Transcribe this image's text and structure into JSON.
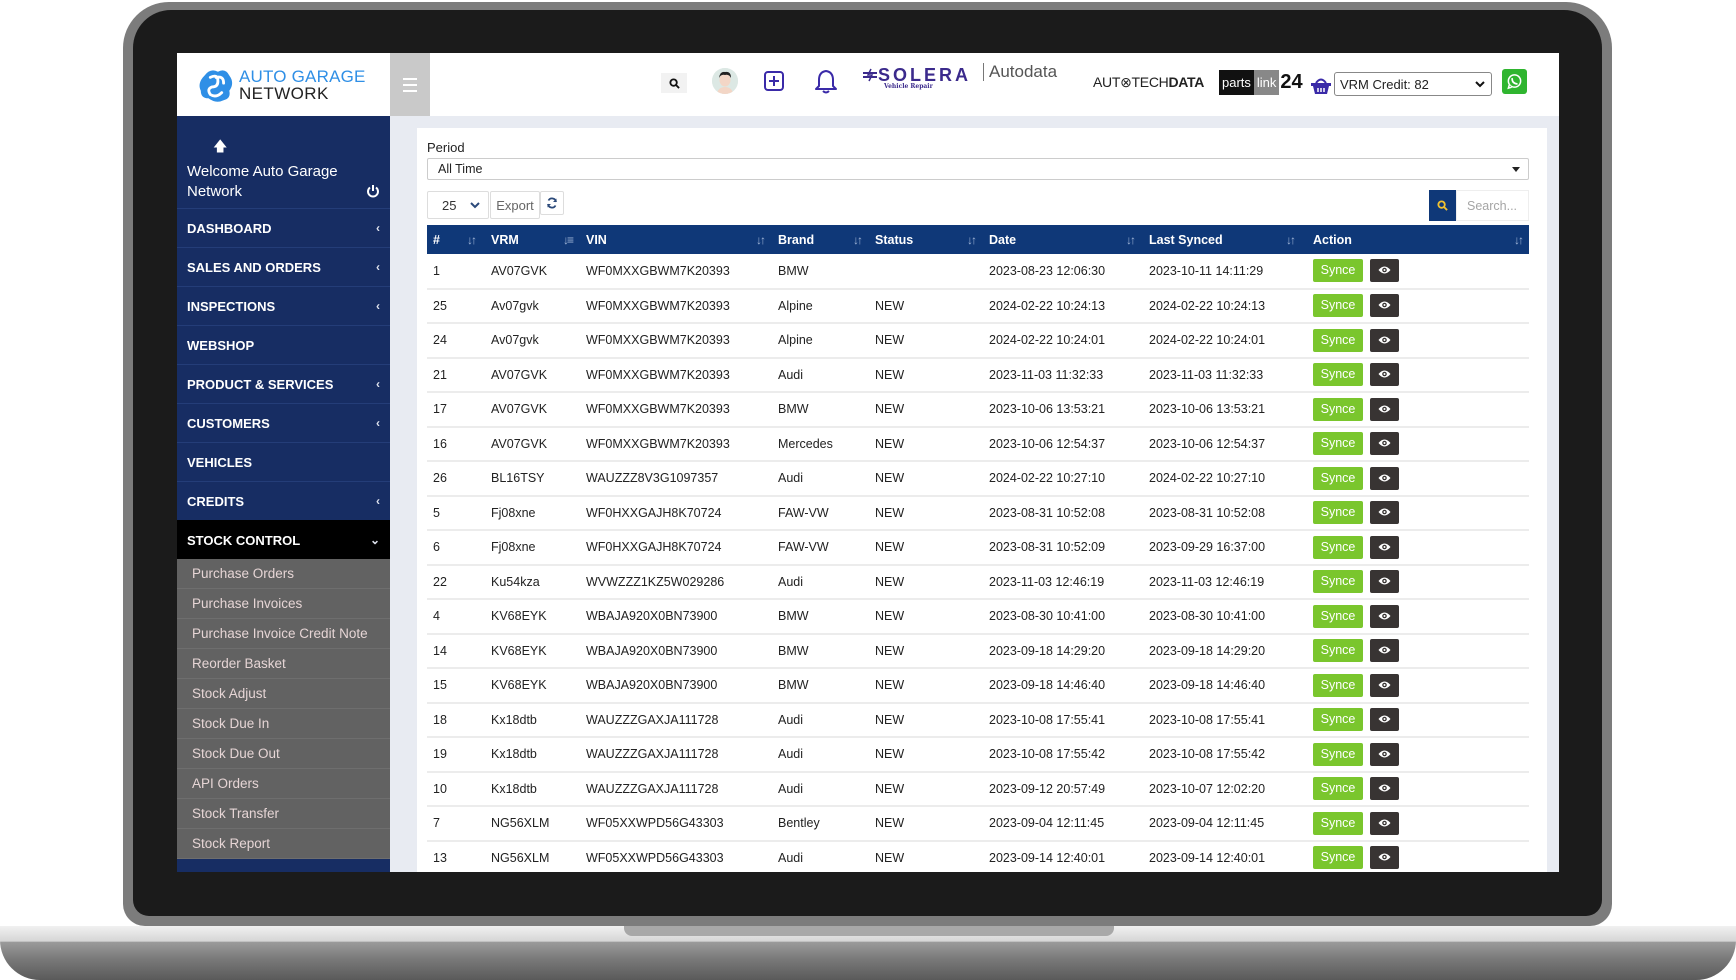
{
  "brand": {
    "logo_line1": "AUTO GARAGE",
    "logo_line2": "NETWORK",
    "accent_color": "#2f8fe6",
    "sidebar_color": "#172d63",
    "table_header_color": "#0f3878",
    "synce_button_color": "#7ac62d"
  },
  "topbar": {
    "partners": {
      "solera": "SOLERA",
      "solera_sub": "Vehicle Repair",
      "autodata": "Autodata",
      "autotech_prefix": "AUT",
      "autotech_mid": "TECH",
      "autotech_suffix": "DATA",
      "partslink_a": "parts",
      "partslink_b": "link",
      "partslink_c": "24"
    },
    "vrm_credit": "VRM Credit: 82"
  },
  "sidebar": {
    "welcome": "Welcome Auto Garage Network",
    "items": [
      {
        "label": "DASHBOARD",
        "chevron": "‹"
      },
      {
        "label": "SALES AND ORDERS",
        "chevron": "‹"
      },
      {
        "label": "INSPECTIONS",
        "chevron": "‹"
      },
      {
        "label": "WEBSHOP",
        "chevron": ""
      },
      {
        "label": "PRODUCT & SERVICES",
        "chevron": "‹"
      },
      {
        "label": "CUSTOMERS",
        "chevron": "‹"
      },
      {
        "label": "VEHICLES",
        "chevron": ""
      },
      {
        "label": "CREDITS",
        "chevron": "‹"
      },
      {
        "label": "STOCK CONTROL",
        "chevron": "⌄"
      }
    ],
    "submenu": [
      "Purchase Orders",
      "Purchase Invoices",
      "Purchase Invoice Credit Note",
      "Reorder Basket",
      "Stock Adjust",
      "Stock Due In",
      "Stock Due Out",
      "API Orders",
      "Stock Transfer",
      "Stock Report"
    ]
  },
  "filters": {
    "period_label": "Period",
    "period_value": "All Time",
    "page_size": "25",
    "export_label": "Export",
    "search_placeholder": "Search..."
  },
  "table": {
    "columns": [
      "#",
      "VRM",
      "VIN",
      "Brand",
      "Status",
      "Date",
      "Last Synced",
      "Action"
    ],
    "action_label": "Synce",
    "rows": [
      {
        "id": "1",
        "vrm": "AV07GVK",
        "vin": "WF0MXXGBWM7K20393",
        "brand": "BMW",
        "status": "",
        "date": "2023-08-23 12:06:30",
        "synced": "2023-10-11 14:11:29"
      },
      {
        "id": "25",
        "vrm": "Av07gvk",
        "vin": "WF0MXXGBWM7K20393",
        "brand": "Alpine",
        "status": "NEW",
        "date": "2024-02-22 10:24:13",
        "synced": "2024-02-22 10:24:13"
      },
      {
        "id": "24",
        "vrm": "Av07gvk",
        "vin": "WF0MXXGBWM7K20393",
        "brand": "Alpine",
        "status": "NEW",
        "date": "2024-02-22 10:24:01",
        "synced": "2024-02-22 10:24:01"
      },
      {
        "id": "21",
        "vrm": "AV07GVK",
        "vin": "WF0MXXGBWM7K20393",
        "brand": "Audi",
        "status": "NEW",
        "date": "2023-11-03 11:32:33",
        "synced": "2023-11-03 11:32:33"
      },
      {
        "id": "17",
        "vrm": "AV07GVK",
        "vin": "WF0MXXGBWM7K20393",
        "brand": "BMW",
        "status": "NEW",
        "date": "2023-10-06 13:53:21",
        "synced": "2023-10-06 13:53:21"
      },
      {
        "id": "16",
        "vrm": "AV07GVK",
        "vin": "WF0MXXGBWM7K20393",
        "brand": "Mercedes",
        "status": "NEW",
        "date": "2023-10-06 12:54:37",
        "synced": "2023-10-06 12:54:37"
      },
      {
        "id": "26",
        "vrm": "BL16TSY",
        "vin": "WAUZZZ8V3G1097357",
        "brand": "Audi",
        "status": "NEW",
        "date": "2024-02-22 10:27:10",
        "synced": "2024-02-22 10:27:10"
      },
      {
        "id": "5",
        "vrm": "Fj08xne",
        "vin": "WF0HXXGAJH8K70724",
        "brand": "FAW-VW",
        "status": "NEW",
        "date": "2023-08-31 10:52:08",
        "synced": "2023-08-31 10:52:08"
      },
      {
        "id": "6",
        "vrm": "Fj08xne",
        "vin": "WF0HXXGAJH8K70724",
        "brand": "FAW-VW",
        "status": "NEW",
        "date": "2023-08-31 10:52:09",
        "synced": "2023-09-29 16:37:00"
      },
      {
        "id": "22",
        "vrm": "Ku54kza",
        "vin": "WVWZZZ1KZ5W029286",
        "brand": "Audi",
        "status": "NEW",
        "date": "2023-11-03 12:46:19",
        "synced": "2023-11-03 12:46:19"
      },
      {
        "id": "4",
        "vrm": "KV68EYK",
        "vin": "WBAJA920X0BN73900",
        "brand": "BMW",
        "status": "NEW",
        "date": "2023-08-30 10:41:00",
        "synced": "2023-08-30 10:41:00"
      },
      {
        "id": "14",
        "vrm": "KV68EYK",
        "vin": "WBAJA920X0BN73900",
        "brand": "BMW",
        "status": "NEW",
        "date": "2023-09-18 14:29:20",
        "synced": "2023-09-18 14:29:20"
      },
      {
        "id": "15",
        "vrm": "KV68EYK",
        "vin": "WBAJA920X0BN73900",
        "brand": "BMW",
        "status": "NEW",
        "date": "2023-09-18 14:46:40",
        "synced": "2023-09-18 14:46:40"
      },
      {
        "id": "18",
        "vrm": "Kx18dtb",
        "vin": "WAUZZZGAXJA111728",
        "brand": "Audi",
        "status": "NEW",
        "date": "2023-10-08 17:55:41",
        "synced": "2023-10-08 17:55:41"
      },
      {
        "id": "19",
        "vrm": "Kx18dtb",
        "vin": "WAUZZZGAXJA111728",
        "brand": "Audi",
        "status": "NEW",
        "date": "2023-10-08 17:55:42",
        "synced": "2023-10-08 17:55:42"
      },
      {
        "id": "10",
        "vrm": "Kx18dtb",
        "vin": "WAUZZZGAXJA111728",
        "brand": "Audi",
        "status": "NEW",
        "date": "2023-09-12 20:57:49",
        "synced": "2023-10-07 12:02:20"
      },
      {
        "id": "7",
        "vrm": "NG56XLM",
        "vin": "WF05XXWPD56G43303",
        "brand": "Bentley",
        "status": "NEW",
        "date": "2023-09-04 12:11:45",
        "synced": "2023-09-04 12:11:45"
      },
      {
        "id": "13",
        "vrm": "NG56XLM",
        "vin": "WF05XXWPD56G43303",
        "brand": "Audi",
        "status": "NEW",
        "date": "2023-09-14 12:40:01",
        "synced": "2023-09-14 12:40:01"
      }
    ]
  }
}
